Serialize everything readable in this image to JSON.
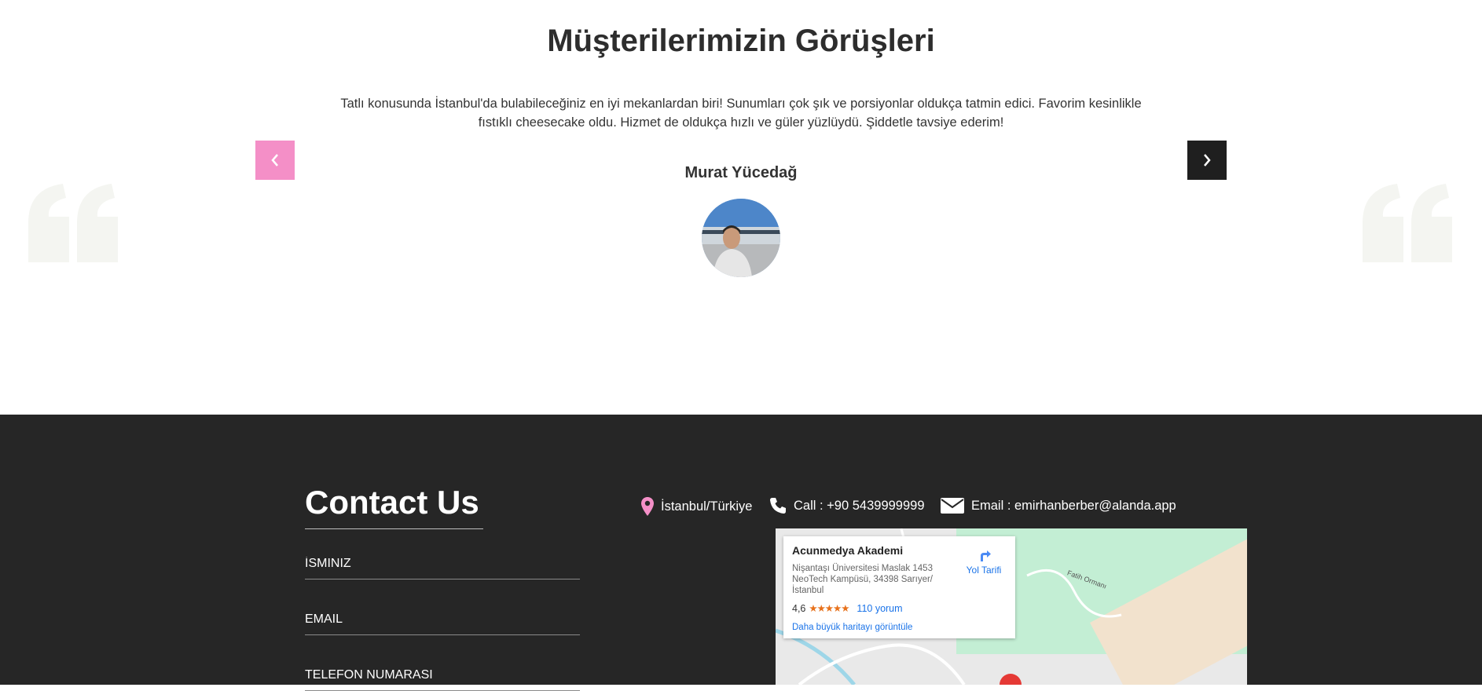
{
  "testimonials": {
    "title": "Müşterilerimizin Görüşleri",
    "quote": "Tatlı konusunda İstanbul'da bulabileceğiniz en iyi mekanlardan biri! Sunumları çok şık ve porsiyonlar oldukça tatmin edici. Favorim kesinlikle fıstıklı cheesecake oldu. Hizmet de oldukça hızlı ve güler yüzlüydü. Şiddetle tavsiye ederim!",
    "author": "Murat Yücedağ",
    "prev_icon": "chevron-left-icon",
    "next_icon": "chevron-right-icon",
    "accent_color": "#f48fc7",
    "dark_button_color": "#1f1f1f"
  },
  "contact": {
    "title": "Contact Us",
    "fields": [
      {
        "placeholder": "İSMINIZ"
      },
      {
        "placeholder": "EMAIL"
      },
      {
        "placeholder": "TELEFON NUMARASI"
      }
    ],
    "location": "İstanbul/Türkiye",
    "phone": "Call : +90 5439999999",
    "email": "Email : emirhanberber@alanda.app",
    "background_color": "#262626"
  },
  "map": {
    "place_name": "Acunmedya Akademi",
    "address": "Nişantaşı Üniversitesi Maslak 1453 NeoTech Kampüsü, 34398 Sarıyer/İstanbul",
    "rating": "4,6",
    "stars": "★★★★★",
    "reviews": "110 yorum",
    "larger_map": "Daha büyük haritayı görüntüle",
    "directions": "Yol Tarifi",
    "road_label": "Fatih Ormanı"
  }
}
